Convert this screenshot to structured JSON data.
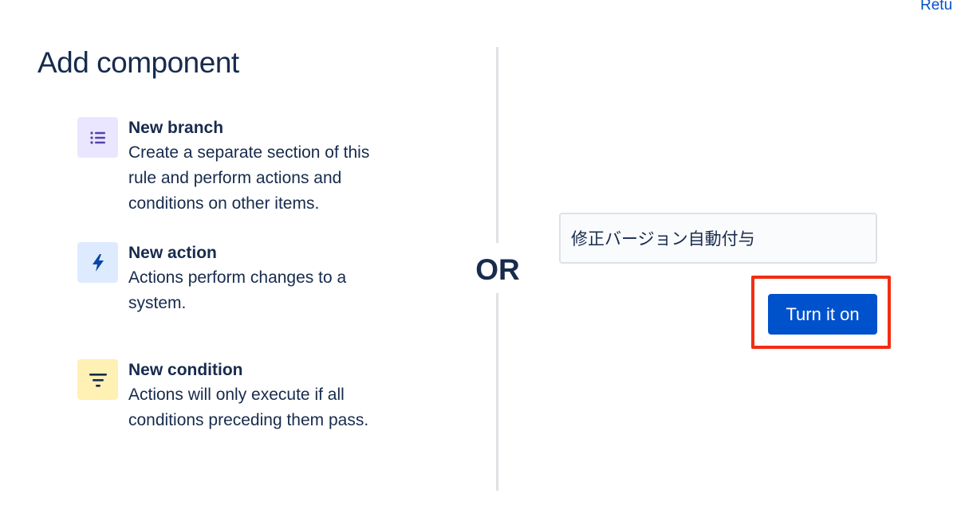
{
  "header": {
    "return_link": "Retu"
  },
  "title": "Add component",
  "components": [
    {
      "name": "New branch",
      "description": "Create a separate section of this rule and perform actions and conditions on other items.",
      "icon": "branch-list-icon",
      "icon_bg": "#eae6ff",
      "icon_color": "#5243aa"
    },
    {
      "name": "New action",
      "description": "Actions perform changes to a system.",
      "icon": "lightning-bolt-icon",
      "icon_bg": "#deebff",
      "icon_color": "#0747a6"
    },
    {
      "name": "New condition",
      "description": "Actions will only execute if all conditions preceding them pass.",
      "icon": "filter-icon",
      "icon_bg": "#fff0b3",
      "icon_color": "#172b4d"
    }
  ],
  "separator": {
    "label": "OR"
  },
  "rule_name": {
    "value": "修正バージョン自動付与"
  },
  "turn_on_button": {
    "label": "Turn it on"
  },
  "colors": {
    "primary": "#0052cc",
    "text": "#172b4d",
    "highlight": "#f22d12",
    "divider": "#dfe1e6"
  }
}
